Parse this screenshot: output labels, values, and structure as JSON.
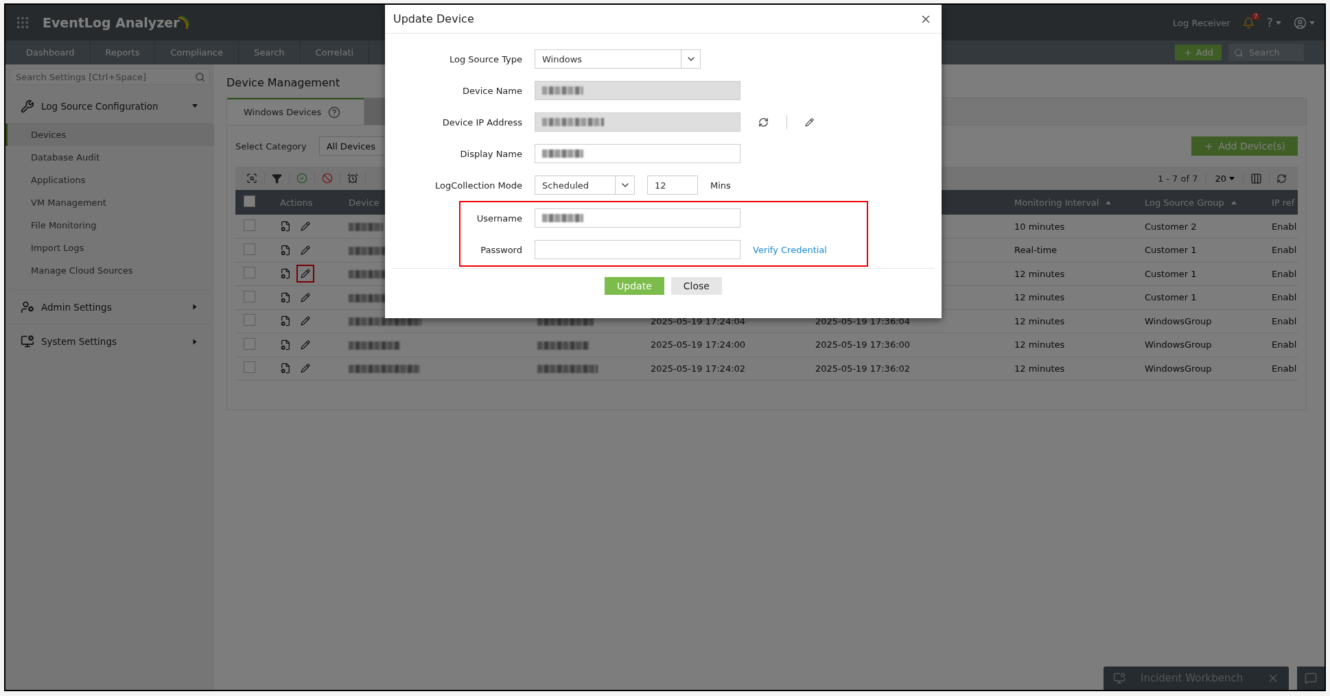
{
  "app": {
    "title": "EventLog Analyzer"
  },
  "header": {
    "link": "Log Receiver",
    "notification_count": "7",
    "help": "?"
  },
  "nav_tabs": [
    {
      "label": "Dashboard"
    },
    {
      "label": "Reports"
    },
    {
      "label": "Compliance"
    },
    {
      "label": "Search"
    },
    {
      "label": "Correlati"
    }
  ],
  "add_button": "Add",
  "search": {
    "placeholder": "Search"
  },
  "sidebar": {
    "search_placeholder": "Search Settings [Ctrl+Space]",
    "sections": [
      {
        "label": "Log Source Configuration",
        "kind": "tools",
        "expanded": true,
        "items": [
          {
            "label": "Devices",
            "selected": true
          },
          {
            "label": "Database Audit",
            "selected": false
          },
          {
            "label": "Applications",
            "selected": false
          },
          {
            "label": "VM Management",
            "selected": false
          },
          {
            "label": "File Monitoring",
            "selected": false
          },
          {
            "label": "Import Logs",
            "selected": false
          },
          {
            "label": "Manage Cloud Sources",
            "selected": false
          }
        ]
      },
      {
        "label": "Admin Settings",
        "kind": "admin",
        "expanded": false
      },
      {
        "label": "System Settings",
        "kind": "system",
        "expanded": false
      }
    ]
  },
  "page": {
    "title": "Device Management",
    "tabs": [
      {
        "label": "Windows Devices",
        "selected": true
      },
      {
        "selected": false
      }
    ],
    "category": {
      "label": "Select Category",
      "value": "All Devices"
    },
    "add_device_button": "Add Device(s)",
    "pagination": {
      "range": "1 - 7 of 7",
      "page_size": "20"
    },
    "table": {
      "all_checked": false,
      "columns": [
        {
          "kind": "actions",
          "label": "Actions"
        },
        {
          "kind": "blurred",
          "label": "Device"
        },
        {
          "kind": "blurred"
        },
        {
          "kind": "text"
        },
        {
          "kind": "text"
        },
        {
          "kind": "text",
          "label": "Monitoring Interval",
          "sorted": true
        },
        {
          "kind": "text",
          "label": "Log Source Group",
          "sorted": true
        },
        {
          "kind": "text",
          "label": "IP ref"
        }
      ],
      "rows": [
        {
          "checked": false,
          "edit_highlighted": false,
          "cells": [
            "10 minutes",
            "Customer 2",
            "Enabl"
          ]
        },
        {
          "checked": false,
          "edit_highlighted": false,
          "cells": [
            "Real-time",
            "Customer 1",
            "Enabl"
          ]
        },
        {
          "checked": false,
          "edit_highlighted": true,
          "cells": [
            "12 minutes",
            "Customer 1",
            "Enabl"
          ]
        },
        {
          "checked": false,
          "edit_highlighted": false,
          "cells": [
            "12 minutes",
            "Customer 1",
            "Enabl"
          ]
        },
        {
          "checked": false,
          "edit_highlighted": false,
          "cells": [
            "2025-05-19 17:24:04",
            "2025-05-19 17:36:04",
            "12 minutes",
            "WindowsGroup",
            "Enabl"
          ]
        },
        {
          "checked": false,
          "edit_highlighted": false,
          "cells": [
            "2025-05-19 17:24:00",
            "2025-05-19 17:36:00",
            "12 minutes",
            "WindowsGroup",
            "Enabl"
          ]
        },
        {
          "checked": false,
          "edit_highlighted": false,
          "cells": [
            "2025-05-19 17:24:02",
            "2025-05-19 17:36:02",
            "12 minutes",
            "WindowsGroup",
            "Enabl"
          ]
        }
      ]
    }
  },
  "modal": {
    "title": "Update Device",
    "fields": [
      {
        "label": "Log Source Type",
        "kind": "select",
        "value": "Windows"
      },
      {
        "label": "Device Name",
        "kind": "blurred",
        "disabled": true
      },
      {
        "label": "Device IP Address",
        "kind": "blurred_ip",
        "disabled": true
      },
      {
        "label": "Display Name",
        "kind": "blurred",
        "disabled": false
      },
      {
        "label": "LogCollection Mode",
        "kind": "schedule",
        "value": "Scheduled",
        "interval": "12",
        "unit": "Mins"
      }
    ],
    "credentials": {
      "highlighted": true,
      "fields": [
        {
          "label": "Username",
          "kind": "blurred",
          "disabled": false
        },
        {
          "label": "Password",
          "kind": "password",
          "link": "Verify Credential",
          "disabled": false
        }
      ]
    },
    "buttons": [
      {
        "label": "Update",
        "kind": "primary"
      },
      {
        "label": "Close",
        "kind": "secondary"
      }
    ]
  },
  "workbench": {
    "label": "Incident Workbench"
  }
}
